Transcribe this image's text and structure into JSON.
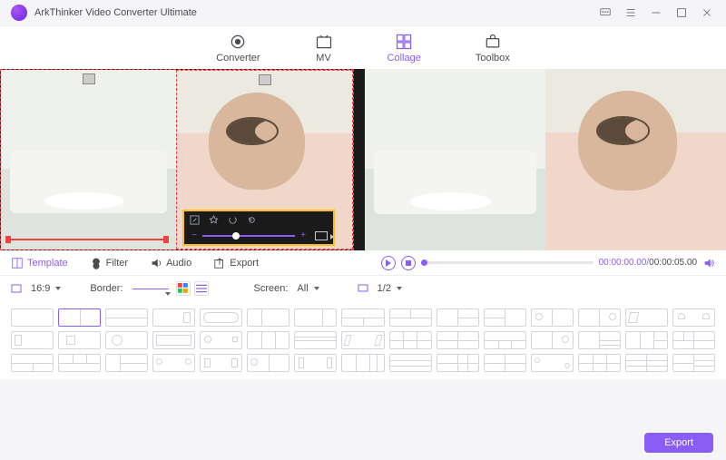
{
  "app": {
    "title": "ArkThinker Video Converter Ultimate"
  },
  "mainTabs": {
    "converter": "Converter",
    "mv": "MV",
    "collage": "Collage",
    "toolbox": "Toolbox"
  },
  "subTabs": {
    "template": "Template",
    "filter": "Filter",
    "audio": "Audio",
    "export": "Export"
  },
  "playback": {
    "current": "00:00:00.00",
    "duration": "00:00:05.00"
  },
  "options": {
    "aspectRatio": "16:9",
    "borderLabel": "Border:",
    "screenLabel": "Screen:",
    "screenValue": "All",
    "pageValue": "1/2"
  },
  "footer": {
    "export": "Export"
  },
  "colors": {
    "accent": "#8b5cf6"
  }
}
